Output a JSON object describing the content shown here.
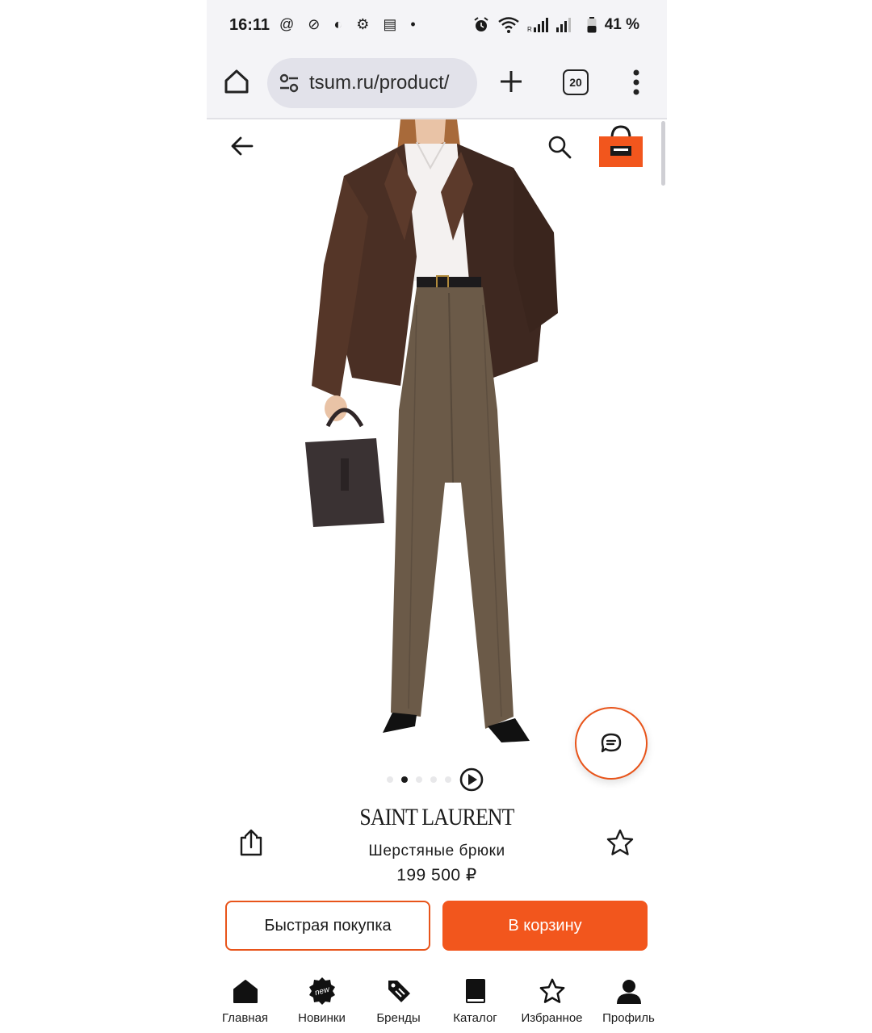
{
  "status": {
    "time": "16:11",
    "left_icons": "@ ⊘ ◐ ⚙ ▤ •",
    "battery": "41 %"
  },
  "browser": {
    "url": "tsum.ru/product/",
    "tabs_count": "20"
  },
  "gallery": {
    "slide_count": 5,
    "active_slide": 2
  },
  "product": {
    "brand": "SAINT LAURENT",
    "name": "Шерстяные брюки",
    "price": "199 500 ₽"
  },
  "actions": {
    "quick_buy": "Быстрая покупка",
    "add_to_cart": "В корзину"
  },
  "nav": {
    "items": [
      {
        "label": "Главная",
        "icon": "home-icon"
      },
      {
        "label": "Новинки",
        "icon": "new-badge-icon"
      },
      {
        "label": "Бренды",
        "icon": "tag-icon"
      },
      {
        "label": "Каталог",
        "icon": "book-icon"
      },
      {
        "label": "Избранное",
        "icon": "star-icon"
      },
      {
        "label": "Профиль",
        "icon": "profile-icon"
      }
    ]
  },
  "colors": {
    "accent": "#f2561d",
    "trousers": "#6b5a48",
    "jacket": "#4a2f24"
  }
}
